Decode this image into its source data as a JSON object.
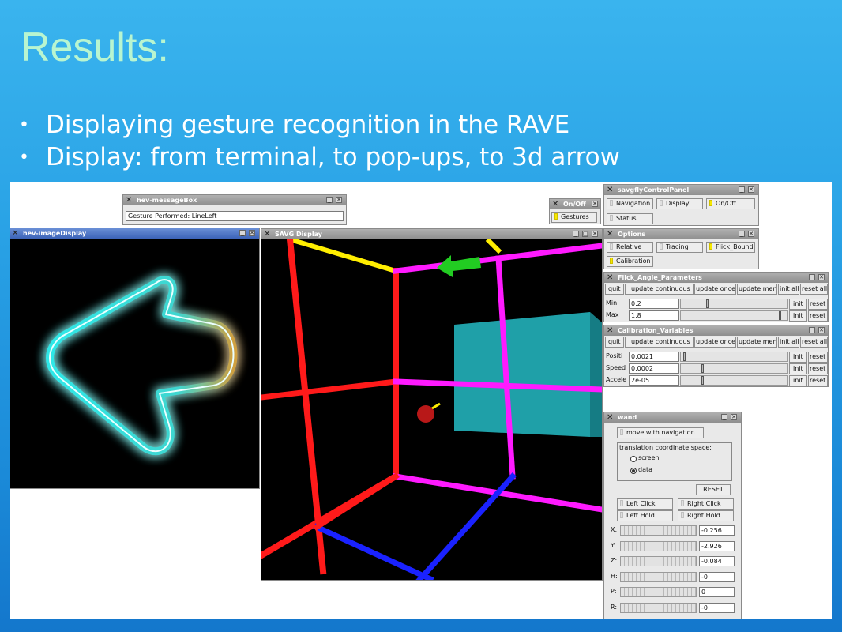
{
  "slide": {
    "title": "Results:",
    "bullets": [
      "Displaying gesture recognition in the RAVE",
      "Display: from terminal, to pop-ups, to 3d arrow"
    ]
  },
  "message_box": {
    "title": "hev-messageBox",
    "text": "Gesture Performed: LineLeft"
  },
  "onoff": {
    "title": "On/Off",
    "button": "Gestures"
  },
  "control_panel": {
    "title": "savgflyControlPanel",
    "buttons": [
      "Navigation",
      "Display",
      "On/Off",
      "Status"
    ]
  },
  "options": {
    "title": "Options",
    "buttons": [
      "Relative",
      "Tracing",
      "Flick_Bounds",
      "Calibration"
    ]
  },
  "flick": {
    "title": "Flick_Angle_Parameters",
    "toolbar": [
      "quit",
      "update continuous",
      "update once",
      "update mem",
      "init all",
      "reset all"
    ],
    "rows": [
      {
        "label": "Min",
        "value": "0.2",
        "init": "init",
        "reset": "reset",
        "level": 0.25
      },
      {
        "label": "Max",
        "value": "1.8",
        "init": "init",
        "reset": "reset",
        "level": 0.97
      }
    ]
  },
  "calibration": {
    "title": "Calibration_Variables",
    "toolbar": [
      "quit",
      "update continuous",
      "update once",
      "update mem",
      "init all",
      "reset all"
    ],
    "rows": [
      {
        "label": "Positi",
        "value": "0.0021",
        "init": "init",
        "reset": "reset",
        "level": 0.02
      },
      {
        "label": "Speed",
        "value": "0.0002",
        "init": "init",
        "reset": "reset",
        "level": 0.2
      },
      {
        "label": "Accele",
        "value": "2e-05",
        "init": "init",
        "reset": "reset",
        "level": 0.2
      }
    ]
  },
  "image_display": {
    "title": "hev-imageDisplay"
  },
  "savg_display": {
    "title": "SAVG Display"
  },
  "wand": {
    "title": "wand",
    "move_button": "move with navigation",
    "group_label": "translation coordinate space:",
    "radio_screen": "screen",
    "radio_data": "data",
    "reset_button": "RESET",
    "left_click": "Left Click",
    "right_click": "Right Click",
    "left_hold": "Left Hold",
    "right_hold": "Right Hold",
    "axes": [
      {
        "label": "X:",
        "value": "-0.256"
      },
      {
        "label": "Y:",
        "value": "-2.926"
      },
      {
        "label": "Z:",
        "value": "-0.084"
      },
      {
        "label": "H:",
        "value": "-0"
      },
      {
        "label": "P:",
        "value": "0"
      },
      {
        "label": "R:",
        "value": "-0"
      }
    ]
  },
  "colors": {
    "slide_title": "#b8f5d0",
    "indicator_on": "#f6e800",
    "arrow_glow": "#38e0e0"
  }
}
